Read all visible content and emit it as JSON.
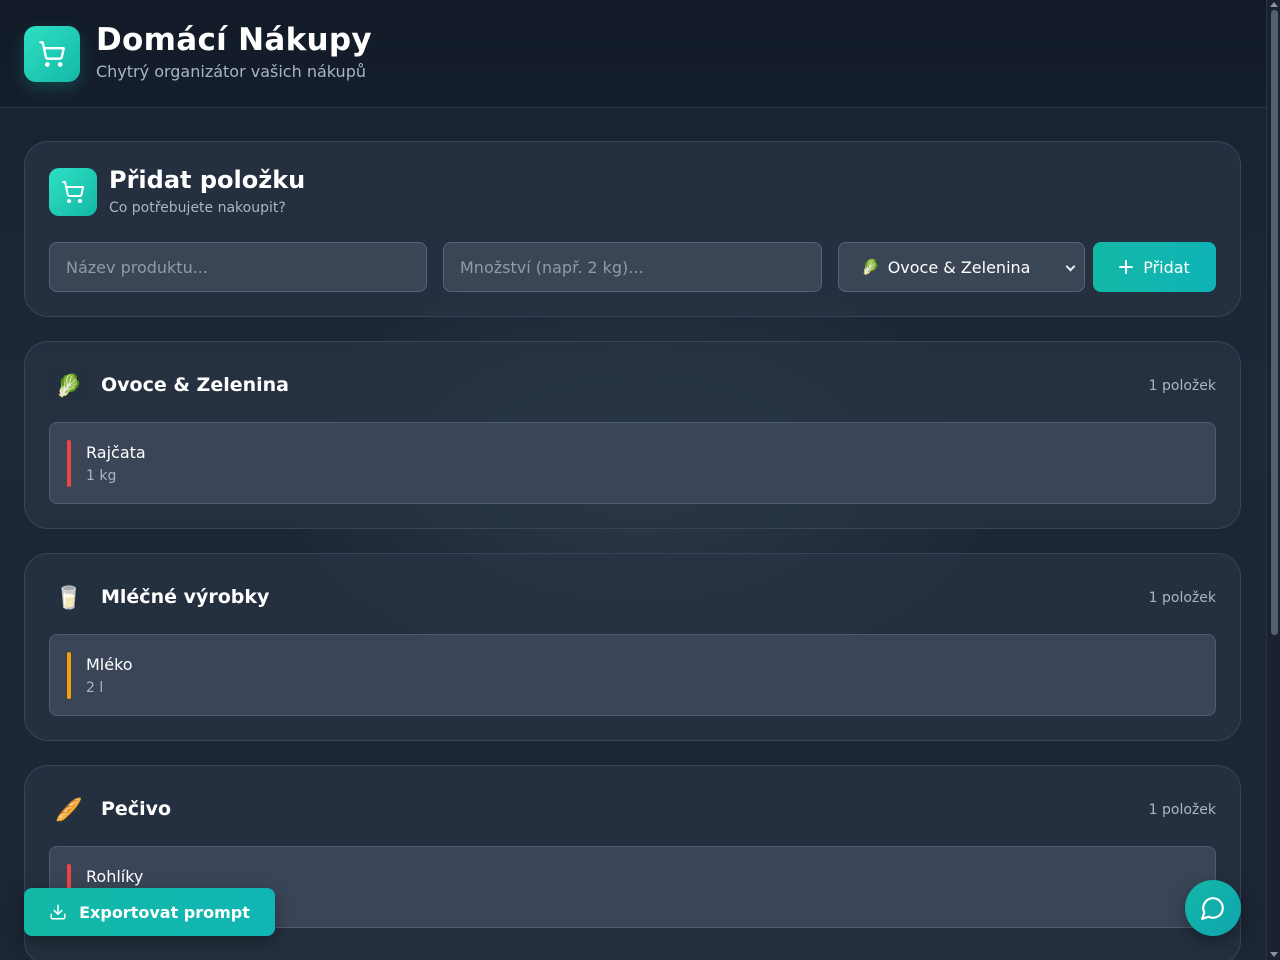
{
  "header": {
    "title": "Domácí Nákupy",
    "subtitle": "Chytrý organizátor vašich nákupů",
    "logo_icon": "shopping-cart-icon"
  },
  "add_form": {
    "title": "Přidat položku",
    "subtitle": "Co potřebujete nakoupit?",
    "name_placeholder": "Název produktu...",
    "name_value": "",
    "quantity_placeholder": "Množství (např. 2 kg)...",
    "quantity_value": "",
    "category_selected_emoji": "🥬",
    "category_selected": "Ovoce & Zelenina",
    "add_button_label": "Přidat"
  },
  "categories": [
    {
      "emoji": "🥬",
      "name": "Ovoce & Zelenina",
      "count_label": "1 položek",
      "items": [
        {
          "name": "Rajčata",
          "quantity": "1 kg",
          "priority_color": "#ef4444"
        }
      ]
    },
    {
      "emoji": "🥛",
      "name": "Mléčné výrobky",
      "count_label": "1 položek",
      "items": [
        {
          "name": "Mléko",
          "quantity": "2 l",
          "priority_color": "#f59e0b"
        }
      ]
    },
    {
      "emoji": "🥖",
      "name": "Pečivo",
      "count_label": "1 položek",
      "items": [
        {
          "name": "Rohlíky",
          "quantity": "",
          "priority_color": "#ef4444"
        }
      ]
    }
  ],
  "export_button_label": "Exportovat prompt",
  "colors": {
    "accent": "#14b8a6",
    "high_priority": "#ef4444",
    "medium_priority": "#f59e0b"
  }
}
